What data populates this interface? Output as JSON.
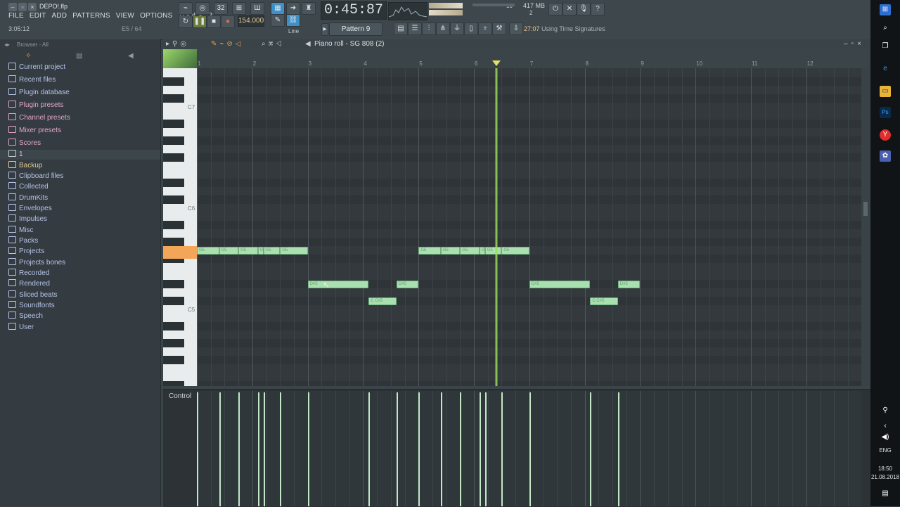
{
  "app": {
    "title": "DEPO!.flp",
    "menu": [
      "FILE",
      "EDIT",
      "ADD",
      "PATTERNS",
      "VIEW",
      "OPTIONS",
      "TOOLS",
      "?"
    ],
    "song_time": "3:05:12",
    "hint_note": "E5 / 64",
    "transport_time": "0:45:87",
    "tempo": "154.000",
    "pattern_label": "Pattern 9",
    "ram_label": "417 MB",
    "cpu_value": "10",
    "voices": "2",
    "hint_prefix": "27:07",
    "hint_text": "Using Time Signatures",
    "snap_label": "Line"
  },
  "browser": {
    "header": "Browser - All",
    "items": [
      {
        "label": "Current project",
        "color": "#b5c3e8"
      },
      {
        "label": "Recent files",
        "color": "#b5c3e8"
      },
      {
        "label": "Plugin database",
        "color": "#b5c3e8"
      },
      {
        "label": "Plugin presets",
        "color": "#e1a4c8"
      },
      {
        "label": "Channel presets",
        "color": "#e1a4c8"
      },
      {
        "label": "Mixer presets",
        "color": "#e1a4c8"
      },
      {
        "label": "Scores",
        "color": "#e1a4c8"
      },
      {
        "label": "1",
        "color": "#c8d0d4"
      },
      {
        "label": "Backup",
        "color": "#e2c992"
      },
      {
        "label": "Clipboard files",
        "color": "#b5c3e8"
      },
      {
        "label": "Collected",
        "color": "#b5c3e8"
      },
      {
        "label": "DrumKits",
        "color": "#b5c3e8"
      },
      {
        "label": "Envelopes",
        "color": "#b5c3e8"
      },
      {
        "label": "Impulses",
        "color": "#b5c3e8"
      },
      {
        "label": "Misc",
        "color": "#b5c3e8"
      },
      {
        "label": "Packs",
        "color": "#b5c3e8"
      },
      {
        "label": "Projects",
        "color": "#b5c3e8"
      },
      {
        "label": "Projects bones",
        "color": "#b5c3e8"
      },
      {
        "label": "Recorded",
        "color": "#b5c3e8"
      },
      {
        "label": "Rendered",
        "color": "#b5c3e8"
      },
      {
        "label": "Sliced beats",
        "color": "#b5c3e8"
      },
      {
        "label": "Soundfonts",
        "color": "#b5c3e8"
      },
      {
        "label": "Speech",
        "color": "#b5c3e8"
      },
      {
        "label": "User",
        "color": "#b5c3e8"
      }
    ]
  },
  "piano_roll": {
    "title": "Piano roll - SG 808 (2)",
    "bar_numbers": [
      "1",
      "2",
      "3",
      "4",
      "5",
      "6",
      "7",
      "8",
      "9",
      "10",
      "11",
      "12"
    ],
    "key_labels": [
      "C7",
      "C6",
      "C5"
    ],
    "control_label": "Control",
    "playhead_bar": 6.4,
    "notes": [
      {
        "label": "G5",
        "pitch": "G5",
        "start": 1.0,
        "len": 0.4
      },
      {
        "label": "G5",
        "pitch": "G5",
        "start": 1.4,
        "len": 0.35
      },
      {
        "label": "G5",
        "pitch": "G5",
        "start": 1.75,
        "len": 0.35
      },
      {
        "label": "G5",
        "pitch": "G5",
        "start": 2.1,
        "len": 0.1
      },
      {
        "label": "G5",
        "pitch": "G5",
        "start": 2.2,
        "len": 0.3
      },
      {
        "label": "G5",
        "pitch": "G5",
        "start": 2.5,
        "len": 0.5
      },
      {
        "label": "D#5",
        "pitch": "D#5",
        "start": 3.0,
        "len": 1.1
      },
      {
        "label": "C C#5",
        "pitch": "C#5",
        "start": 4.1,
        "len": 0.5
      },
      {
        "label": "D#5",
        "pitch": "D#5",
        "start": 4.6,
        "len": 0.4
      },
      {
        "label": "G5",
        "pitch": "G5",
        "start": 5.0,
        "len": 0.4
      },
      {
        "label": "G5",
        "pitch": "G5",
        "start": 5.4,
        "len": 0.35
      },
      {
        "label": "G5",
        "pitch": "G5",
        "start": 5.75,
        "len": 0.35
      },
      {
        "label": "G5",
        "pitch": "G5",
        "start": 6.1,
        "len": 0.1
      },
      {
        "label": "G5",
        "pitch": "G5",
        "start": 6.2,
        "len": 0.3
      },
      {
        "label": "G5",
        "pitch": "G5",
        "start": 6.5,
        "len": 0.5
      },
      {
        "label": "D#5",
        "pitch": "D#5",
        "start": 7.0,
        "len": 1.1
      },
      {
        "label": "C C#5",
        "pitch": "C#5",
        "start": 8.1,
        "len": 0.5
      },
      {
        "label": "D#5",
        "pitch": "D#5",
        "start": 8.6,
        "len": 0.4
      }
    ]
  },
  "taskbar": {
    "lang": "ENG",
    "time": "18:50",
    "date": "21.08.2018"
  }
}
